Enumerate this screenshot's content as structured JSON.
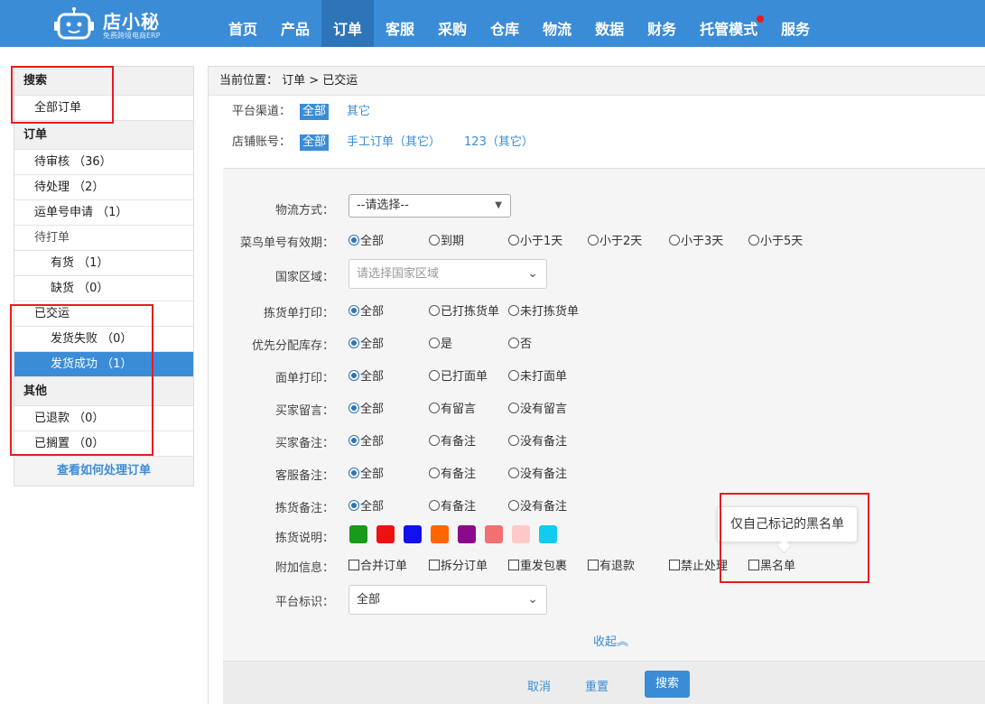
{
  "logo": {
    "title": "店小秘",
    "subtitle": "免费跨境电商ERP"
  },
  "nav": {
    "items": [
      {
        "label": "首页"
      },
      {
        "label": "产品"
      },
      {
        "label": "订单"
      },
      {
        "label": "客服"
      },
      {
        "label": "采购"
      },
      {
        "label": "仓库"
      },
      {
        "label": "物流"
      },
      {
        "label": "数据"
      },
      {
        "label": "财务"
      },
      {
        "label": "托管模式"
      },
      {
        "label": "服务"
      }
    ],
    "active_index": 2,
    "accent": "#3b8cd6",
    "notify_dot_color": "#e81c1c"
  },
  "sidebar": {
    "search": {
      "title": "搜索",
      "all_orders": "全部订单"
    },
    "orders": {
      "title": "订单",
      "pending_review": "待审核 （36）",
      "pending_process": "待处理 （2）",
      "waybill_apply": "运单号申请 （1）",
      "pending_print": "待打单",
      "in_stock": "有货 （1）",
      "out_of_stock": "缺货 （0）",
      "shipped": "已交运",
      "ship_failed": "发货失败 （0）",
      "ship_success": "发货成功 （1）"
    },
    "other": {
      "title": "其他",
      "refunded": "已退款 （0）",
      "on_hold": "已搁置 （0）"
    },
    "help_link": "查看如何处理订单"
  },
  "main": {
    "breadcrumb": "当前位置： 订单 > 已交运",
    "platform": {
      "label": "平台渠道：",
      "all": "全部",
      "other": "其它"
    },
    "store": {
      "label": "店铺账号：",
      "all": "全部",
      "manual": "手工订单（其它）",
      "account": "123（其它）"
    }
  },
  "form": {
    "logistics": {
      "label": "物流方式：",
      "value": "--请选择--"
    },
    "cainiao_validity": {
      "label": "菜鸟单号有效期：",
      "options": [
        "全部",
        "到期",
        "小于1天",
        "小于2天",
        "小于3天",
        "小于5天"
      ],
      "selected": 0
    },
    "country": {
      "label": "国家区域：",
      "placeholder": "请选择国家区域"
    },
    "pick_print": {
      "label": "拣货单打印：",
      "options": [
        "全部",
        "已打拣货单",
        "未打拣货单"
      ],
      "selected": 0
    },
    "priority_stock": {
      "label": "优先分配库存：",
      "options": [
        "全部",
        "是",
        "否"
      ],
      "selected": 0
    },
    "sheet_print": {
      "label": "面单打印：",
      "options": [
        "全部",
        "已打面单",
        "未打面单"
      ],
      "selected": 0
    },
    "buyer_message": {
      "label": "买家留言：",
      "options": [
        "全部",
        "有留言",
        "没有留言"
      ],
      "selected": 0
    },
    "buyer_note": {
      "label": "买家备注：",
      "options": [
        "全部",
        "有备注",
        "没有备注"
      ],
      "selected": 0
    },
    "cs_note": {
      "label": "客服备注：",
      "options": [
        "全部",
        "有备注",
        "没有备注"
      ],
      "selected": 0
    },
    "pick_note": {
      "label": "拣货备注：",
      "options": [
        "全部",
        "有备注",
        "没有备注"
      ],
      "selected": 0
    },
    "pick_desc": {
      "label": "拣货说明：",
      "colors": [
        "#1a9a1a",
        "#ee1111",
        "#1111ee",
        "#ff6600",
        "#8b0a8b",
        "#f46f6f",
        "#ffc9c9",
        "#11ccf0"
      ]
    },
    "extra_info": {
      "label": "附加信息：",
      "options": [
        "合并订单",
        "拆分订单",
        "重发包裹",
        "有退款",
        "禁止处理",
        "黑名单"
      ]
    },
    "platform_tag": {
      "label": "平台标识：",
      "value": "全部"
    },
    "collapse": "收起︽",
    "cancel": "取消",
    "reset": "重置",
    "search": "搜索"
  },
  "tooltip": {
    "text": "仅自己标记的黑名单"
  }
}
